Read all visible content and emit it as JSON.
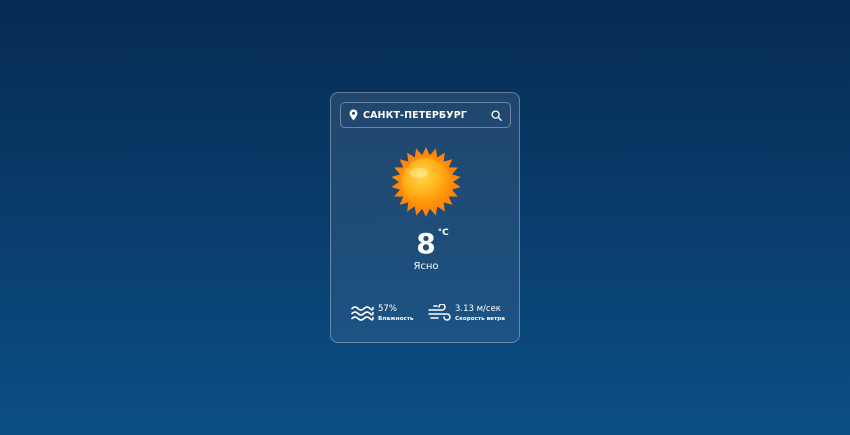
{
  "search": {
    "city_value": "Санкт-Петербург",
    "location_icon": "location-pin-icon",
    "search_icon": "search-icon"
  },
  "weather": {
    "icon": "sun-icon",
    "temperature": "8",
    "unit": "°C",
    "description": "Ясно"
  },
  "details": {
    "humidity": {
      "icon": "humidity-waves-icon",
      "value": "57%",
      "label": "Влажность"
    },
    "wind": {
      "icon": "wind-icon",
      "value": "3.13 м/сек",
      "label": "Скорость ветра"
    }
  },
  "colors": {
    "background_top": "#062b54",
    "background_bottom": "#0b4f86",
    "sun_core": "#ffb21a",
    "sun_rays": "#ff8a00"
  }
}
